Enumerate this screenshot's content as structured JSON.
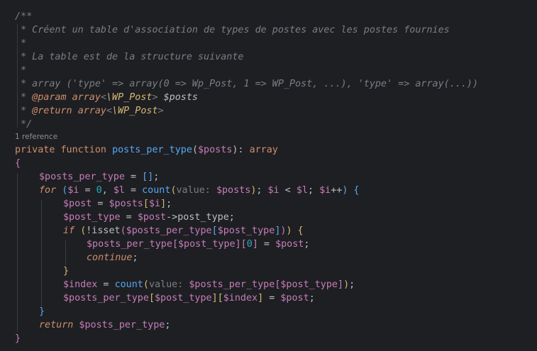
{
  "editor": {
    "language": "php",
    "theme_colors": {
      "background": "#1e1f22",
      "comment": "#7a7e85",
      "keyword": "#cf8e6d",
      "function": "#56a8f5",
      "variable": "#c77dbb",
      "number": "#2aacb8",
      "text": "#bcbec4"
    },
    "code_vision": {
      "references": "1 reference"
    },
    "doc": {
      "open": "/**",
      "l1": " * Créent un table d'association de types de postes avec les postes fournies",
      "blank": " *",
      "l3": " * La table est de la structure suivante",
      "l5": " * array ('type' => array(0 => Wp_Post, 1 => WP_Post, ...), 'type' => array(...))",
      "star": " * ",
      "param_tag": "@param",
      "param_type": "array",
      "param_lt": "<",
      "param_cls": "\\WP_Post",
      "param_gt": ">",
      "param_var": "$posts",
      "return_tag": "@return",
      "return_type": "array",
      "return_lt": "<",
      "return_cls": "\\WP_Post",
      "return_gt": ">",
      "close": " */"
    },
    "code": {
      "private": "private",
      "function": "function",
      "fn_name": "posts_per_type",
      "lparen": "(",
      "param": "$posts",
      "rparen_colon": "): ",
      "ret_type": "array",
      "open_brace": "{",
      "l1_var": "$posts_per_type",
      "l1_eq": " = ",
      "l1_arr": "[]",
      "l1_semi": ";",
      "for": "for",
      "for_paren": "(",
      "i_var": "$i",
      "eq0": " = ",
      "zero": "0",
      "comma": ", ",
      "l_var": "$l",
      "eq_count": " = ",
      "count": "count",
      "count_paren": "(",
      "hint_value": "value: ",
      "posts_arg": "$posts",
      "count_close": ")",
      "semi1": "; ",
      "i_var2": "$i",
      "lt": " < ",
      "l_var2": "$l",
      "semi2": "; ",
      "i_var3": "$i",
      "incr": "++",
      "for_close": ")",
      "for_brace": " {",
      "post_var": "$post",
      "post_eq": " = ",
      "posts_var": "$posts",
      "br_open": "[",
      "idx_i": "$i",
      "br_close": "]",
      "post_semi": ";",
      "post_type_var": "$post_type",
      "pt_eq": " = ",
      "pt_post": "$post",
      "pt_arrow": "->post_type;",
      "if": "if",
      "if_open": "(",
      "not_isset": "!isset",
      "isset_paren": "(",
      "ppt_var": "$posts_per_type",
      "b1": "[",
      "pt_var2": "$post_type",
      "b2": "]",
      "isset_close": ")",
      "if_close": ")",
      "if_brace": " {",
      "as_ppt": "$posts_per_type",
      "as_b1": "[",
      "as_pt": "$post_type",
      "as_b2": "][",
      "as_zero": "0",
      "as_b3": "]",
      "as_eq": " = ",
      "as_post": "$post",
      "as_semi": ";",
      "continue": "continue",
      "continue_semi": ";",
      "if_end": "}",
      "index_var": "$index",
      "idx_eq": " = ",
      "count2": "count",
      "count2_paren": "(",
      "hint_value2": "value: ",
      "c2_ppt": "$posts_per_type",
      "c2_b1": "[",
      "c2_pt": "$post_type",
      "c2_b2": "]",
      "c2_close": ")",
      "c2_semi": ";",
      "fin_ppt": "$posts_per_type",
      "fin_b1": "[",
      "fin_pt": "$post_type",
      "fin_b2": "][",
      "fin_idx": "$index",
      "fin_b3": "]",
      "fin_eq": " = ",
      "fin_post": "$post",
      "fin_semi": ";",
      "for_end": "}",
      "return": "return",
      "ret_var": " $posts_per_type",
      "ret_semi": ";",
      "close_brace": "}"
    }
  }
}
